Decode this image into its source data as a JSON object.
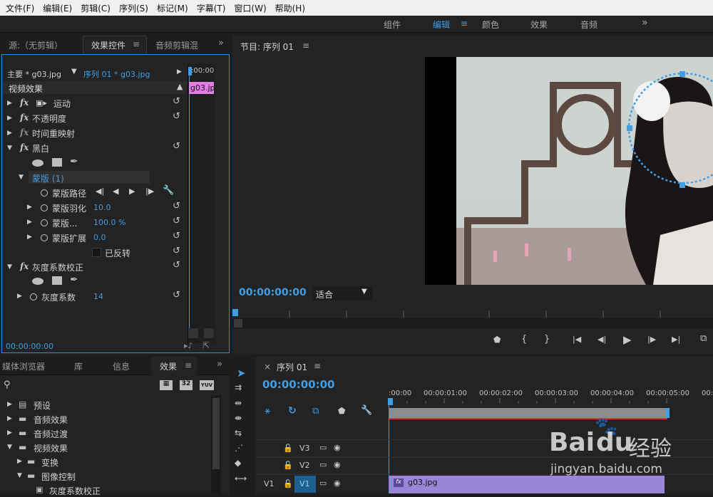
{
  "menu": [
    "文件(F)",
    "编辑(E)",
    "剪辑(C)",
    "序列(S)",
    "标记(M)",
    "字幕(T)",
    "窗口(W)",
    "帮助(H)"
  ],
  "workspaces": {
    "items": [
      "组件",
      "编辑",
      "颜色",
      "效果",
      "音频"
    ],
    "active": "编辑",
    "more": "»",
    "menu_icon": "≡"
  },
  "source_panel": {
    "tabs": [
      "源:（无剪辑）",
      "效果控件",
      "音频剪辑混"
    ],
    "active_tab": "效果控件",
    "menu_icon": "≡",
    "more": "»",
    "master": "主要 * g03.jpg",
    "sequence": "序列 01 * g03.jpg",
    "tl_time": ":00:00",
    "clip": "g03.jp",
    "section": "视频效果",
    "effects": {
      "motion": "运动",
      "opacity": "不透明度",
      "time_remap": "时间重映射",
      "bw": "黑白",
      "mask": "蒙版 (1)",
      "mask_path": "蒙版路径",
      "mask_feather": "蒙版羽化",
      "mask_feather_val": "10.0",
      "mask_opacity": "蒙版...",
      "mask_opacity_val": "100.0 %",
      "mask_expansion": "蒙版扩展",
      "mask_expansion_val": "0.0",
      "inverted": "已反转",
      "gamma": "灰度系数校正",
      "gamma_prop": "灰度系数",
      "gamma_val": "14"
    },
    "timecode": "00:00:00:00"
  },
  "program_panel": {
    "title": "节目: 序列 01",
    "menu_icon": "≡",
    "timecode": "00:00:00:00",
    "fit": "适合"
  },
  "effects_panel": {
    "tabs": [
      "媒体浏览器",
      "库",
      "信息",
      "效果"
    ],
    "active_tab": "效果",
    "menu_icon": "≡",
    "more": "»",
    "badges": [
      "32",
      "YUV"
    ],
    "tree": [
      "预设",
      "音频效果",
      "音频过渡",
      "视频效果",
      "变换",
      "图像控制",
      "灰度系数校正"
    ]
  },
  "timeline": {
    "tab": "序列 01",
    "close": "×",
    "menu_icon": "≡",
    "timecode": "00:00:00:00",
    "ruler": [
      ":00:00",
      "00:00:01:00",
      "00:00:02:00",
      "00:00:03:00",
      "00:00:04:00",
      "00:00:05:00",
      "00:0"
    ],
    "tracks": [
      {
        "name": "V3"
      },
      {
        "name": "V2"
      },
      {
        "name": "V1",
        "target": "V1"
      }
    ],
    "clip": "g03.jpg",
    "clip_badge": "fx"
  },
  "watermark": {
    "brand": "Bai",
    "brand2": "du",
    "product": "经验",
    "url": "jingyan.baidu.com"
  },
  "colors": {
    "accent": "#3f9ee6",
    "clip_pink": "#e47ee6",
    "clip_purple": "#9a86d6"
  }
}
